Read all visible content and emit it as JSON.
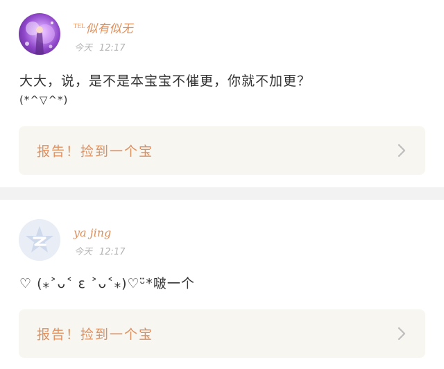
{
  "posts": [
    {
      "username_prefix": "TEL",
      "username": "似有似无",
      "date": "今天",
      "time": "12:17",
      "content_line1": "大大，说，是不是本宝宝不催更，你就不加更？",
      "content_line2": "(*^▽^*)",
      "report_label": "报告！捡到一个宝"
    },
    {
      "username_prefix": "",
      "username": "ya jing",
      "date": "今天",
      "time": "12:17",
      "content_line1": "♡ (⁎˃ᴗ˂ ε ˃ᴗ˂⁎)♡ᵕ̈*啵一个",
      "content_line2": "",
      "report_label": "报告！捡到一个宝"
    }
  ],
  "colors": {
    "accent": "#e0905e",
    "timestamp": "#b2b2b2",
    "text": "#333333",
    "card_bg": "#f7f6f1",
    "separator": "#f2f2f2"
  },
  "icons": {
    "avatar_1": "avatar-image",
    "avatar_2": "qq-default-avatar-icon",
    "chevron": "chevron-right-icon"
  }
}
